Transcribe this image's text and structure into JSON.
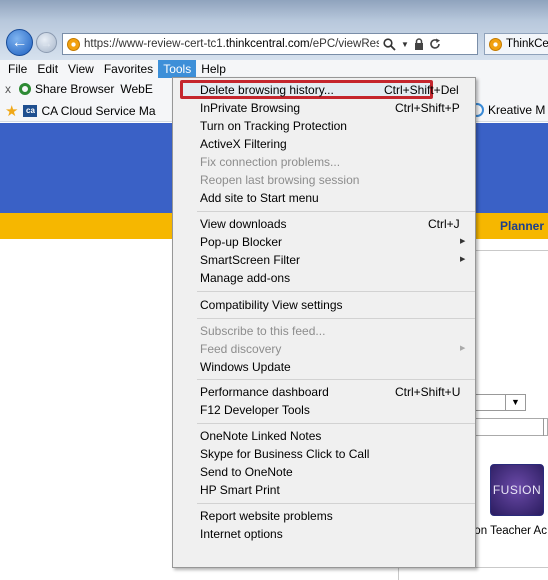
{
  "browser": {
    "url_prefix": "https://www-review-cert-tc1.",
    "url_domain": "thinkcentral.com",
    "url_path": "/ePC/viewRes",
    "tab_title": "ThinkCe"
  },
  "menubar": {
    "items": [
      "File",
      "Edit",
      "View",
      "Favorites",
      "Tools",
      "Help"
    ],
    "active": "Tools"
  },
  "command_bar": {
    "close_glyph": "x",
    "share_browser": "Share Browser",
    "webe": "WebE"
  },
  "favorites": {
    "ca_cloud": "CA Cloud Service Ma",
    "kreative": "Kreative M"
  },
  "page": {
    "planner": "Planner",
    "fusion_word": "FUSION",
    "tile_caption": "sion Teacher Ac",
    "colors": {
      "banner": "#3a61c6",
      "strip": "#f6b700"
    }
  },
  "tools_menu": {
    "items": {
      "delete_history": "Delete browsing history...",
      "inprivate": "InPrivate Browsing",
      "tracking": "Turn on Tracking Protection",
      "activex": "ActiveX Filtering",
      "fix_connection": "Fix connection problems...",
      "reopen": "Reopen last browsing session",
      "add_start": "Add site to Start menu",
      "view_downloads": "View downloads",
      "popup_blocker": "Pop-up Blocker",
      "smartscreen": "SmartScreen Filter",
      "manage_addons": "Manage add-ons",
      "compat_view": "Compatibility View settings",
      "subscribe_feed": "Subscribe to this feed...",
      "feed_discovery": "Feed discovery",
      "windows_update": "Windows Update",
      "perf_dashboard": "Performance dashboard",
      "f12": "F12 Developer Tools",
      "onenote_linked": "OneNote Linked Notes",
      "skype": "Skype for Business Click to Call",
      "send_onenote": "Send to OneNote",
      "hp_print": "HP Smart Print",
      "report_problems": "Report website problems",
      "internet_options": "Internet options"
    },
    "shortcuts": {
      "delete_history": "Ctrl+Shift+Del",
      "inprivate": "Ctrl+Shift+P",
      "view_downloads": "Ctrl+J",
      "perf_dashboard": "Ctrl+Shift+U"
    },
    "highlight_color": "#c4262e"
  }
}
